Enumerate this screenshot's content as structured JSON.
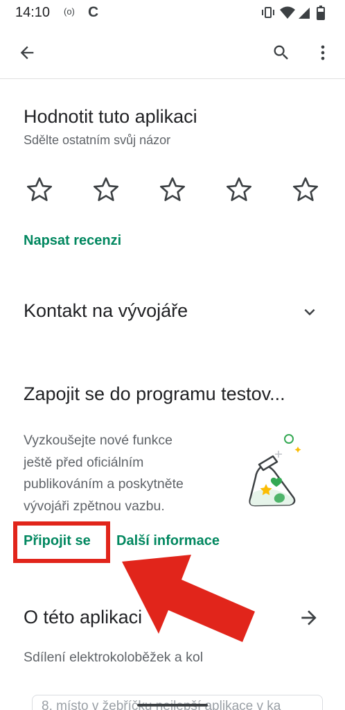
{
  "status_bar": {
    "time": "14:10",
    "hotspot_glyph": "(o)",
    "c_glyph": "C",
    "icons": [
      "vibrate-icon",
      "wifi-icon",
      "signal-icon",
      "battery-icon"
    ]
  },
  "toolbar": {
    "back_icon": "arrow-left-icon",
    "search_icon": "search-icon",
    "more_icon": "more-vert-icon"
  },
  "rate": {
    "title": "Hodnotit tuto aplikaci",
    "subtitle": "Sdělte ostatním svůj názor",
    "stars": 5,
    "rating": 0,
    "write_review": "Napsat recenzi"
  },
  "developer_contact": {
    "title": "Kontakt na vývojáře",
    "icon": "chevron-down-icon"
  },
  "testing": {
    "title": "Zapojit se do programu testov...",
    "description_lines": [
      "Vyzkoušejte nové funkce",
      "ještě před oficiálním",
      "publikováním a poskytněte",
      "vývojáři zpětnou vazbu."
    ],
    "join_label": "Připojit se",
    "more_info_label": "Další informace",
    "illustration": "flask-illustration"
  },
  "about": {
    "title": "O této aplikaci",
    "icon": "arrow-right-icon",
    "subtitle": "Sdílení elektrokoloběžek a kol",
    "peek_text": "8. místo v žebříčku nejlepší aplikace v ka"
  },
  "colors": {
    "accent": "#01875f",
    "highlight": "#e1251b",
    "text": "#202124",
    "secondary": "#5f6368"
  }
}
